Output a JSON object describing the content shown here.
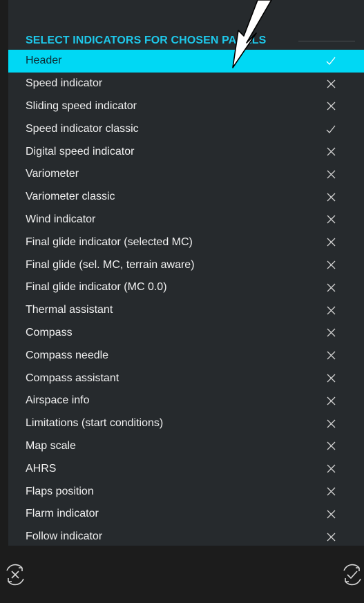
{
  "section_title": "SELECT INDICATORS FOR CHOSEN PANELS",
  "items": [
    {
      "label": "Header",
      "state": "check",
      "selected": true
    },
    {
      "label": "Speed indicator",
      "state": "x"
    },
    {
      "label": "Sliding speed indicator",
      "state": "x"
    },
    {
      "label": "Speed indicator classic",
      "state": "check"
    },
    {
      "label": "Digital speed indicator",
      "state": "x"
    },
    {
      "label": "Variometer",
      "state": "x"
    },
    {
      "label": "Variometer classic",
      "state": "x"
    },
    {
      "label": "Wind indicator",
      "state": "x"
    },
    {
      "label": "Final glide indicator (selected MC)",
      "state": "x"
    },
    {
      "label": "Final glide (sel. MC, terrain aware)",
      "state": "x"
    },
    {
      "label": "Final glide indicator (MC 0.0)",
      "state": "x"
    },
    {
      "label": "Thermal assistant",
      "state": "x"
    },
    {
      "label": "Compass",
      "state": "x"
    },
    {
      "label": "Compass needle",
      "state": "x"
    },
    {
      "label": "Compass assistant",
      "state": "x"
    },
    {
      "label": "Airspace info",
      "state": "x"
    },
    {
      "label": "Limitations (start conditions)",
      "state": "x"
    },
    {
      "label": "Map scale",
      "state": "x"
    },
    {
      "label": "AHRS",
      "state": "x"
    },
    {
      "label": "Flaps position",
      "state": "x"
    },
    {
      "label": "Flarm indicator",
      "state": "x"
    },
    {
      "label": "Follow indicator",
      "state": "x"
    }
  ],
  "bottom_bar": {
    "left_icon": "cancel-rotate-icon",
    "right_icon": "confirm-rotate-icon"
  },
  "colors": {
    "accent": "#1ec8ea",
    "selected_row": "#00d8f4",
    "panel": "#262a2d",
    "background": "#1c1c1c"
  }
}
